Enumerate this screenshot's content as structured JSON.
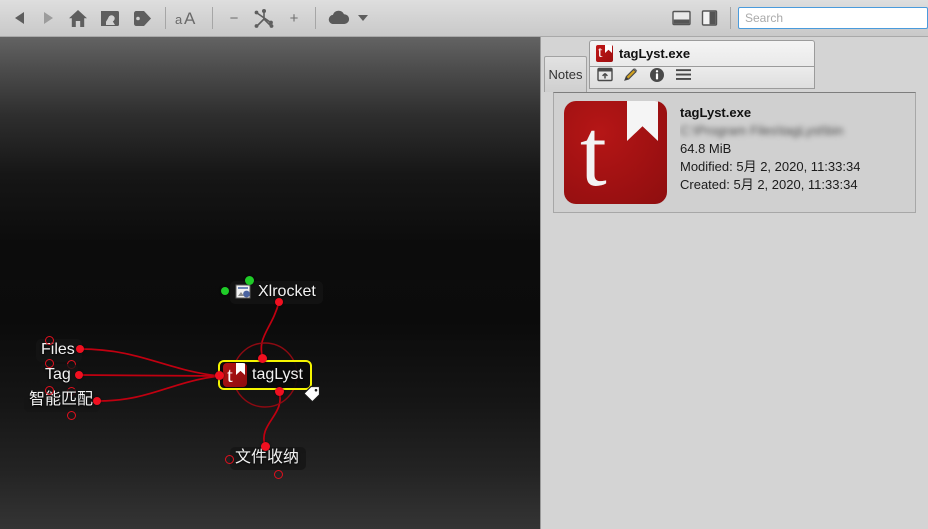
{
  "toolbar": {
    "items": [
      {
        "name": "back-button",
        "icon": "triangle-left-icon",
        "label": "Back"
      },
      {
        "name": "forward-button",
        "icon": "triangle-right-icon",
        "label": "Forward"
      },
      {
        "name": "home-button",
        "icon": "home-icon",
        "label": "Home"
      },
      {
        "name": "picture-tag-button",
        "icon": "image-tag-icon",
        "label": "Image Tag"
      },
      {
        "name": "tag-button",
        "icon": "tag-icon",
        "label": "Tag"
      },
      {
        "name": "font-size-button",
        "icon": "font-size-icon",
        "label": "aA"
      },
      {
        "name": "zoom-out-button",
        "icon": "minus-icon",
        "label": "−"
      },
      {
        "name": "graph-view-button",
        "icon": "network-graph-icon",
        "label": "Graph"
      },
      {
        "name": "zoom-in-button",
        "icon": "plus-icon",
        "label": "+"
      },
      {
        "name": "cloud-button",
        "icon": "cloud-icon",
        "label": "Cloud"
      }
    ],
    "layout_buttons": [
      {
        "name": "layout-bottom-panel-button",
        "icon": "panel-bottom-icon"
      },
      {
        "name": "layout-side-panel-button",
        "icon": "panel-side-icon"
      }
    ],
    "search": {
      "value": "",
      "placeholder": "Search"
    },
    "accent_focus_color": "#4a9bdc"
  },
  "canvas": {
    "nodes": [
      {
        "id": "xlrocket",
        "label": "Xlrocket",
        "icon": "document-icon",
        "selected": false,
        "dot_color": "#1fcc28"
      },
      {
        "id": "files",
        "label": "Files",
        "icon": "none",
        "selected": false,
        "dot_color": "#f01020"
      },
      {
        "id": "tag",
        "label": "Tag",
        "icon": "none",
        "selected": false,
        "dot_color": "#f01020"
      },
      {
        "id": "smart",
        "label": "智能匹配",
        "icon": "none",
        "selected": false,
        "dot_color": "#f01020"
      },
      {
        "id": "taglyst",
        "label": "tagLyst",
        "icon": "taglyst-app-icon",
        "selected": true,
        "dot_color": "#f01020"
      },
      {
        "id": "folder",
        "label": "文件收纳",
        "icon": "none",
        "selected": false,
        "dot_color": "#f01020"
      }
    ],
    "edge_color": "#c00010",
    "selection_color": "#f5f500",
    "cursor_icon": "tag-cursor-icon"
  },
  "panel": {
    "notes_tab_label": "Notes",
    "add_tab_label": "+",
    "document_tab": {
      "title": "tagLyst.exe",
      "icon": "taglyst-app-icon",
      "tools": [
        {
          "name": "open-external-button",
          "icon": "open-external-icon"
        },
        {
          "name": "edit-button",
          "icon": "pencil-icon"
        },
        {
          "name": "info-button",
          "icon": "info-circle-icon"
        },
        {
          "name": "menu-button",
          "icon": "hamburger-menu-icon"
        }
      ]
    },
    "file_info": {
      "name": "tagLyst.exe",
      "path_redacted": "C:\\Program Files\\tagLyst\\bin",
      "size": "64.8 MiB",
      "modified": "Modified: 5月 2, 2020, 11:33:34",
      "created": "Created: 5月 2, 2020, 11:33:34"
    }
  }
}
